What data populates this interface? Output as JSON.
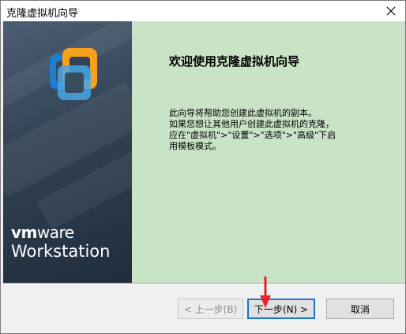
{
  "window": {
    "title": "克隆虚拟机向导"
  },
  "sidebar": {
    "brand_vm": "vm",
    "brand_ware": "ware",
    "brand_product": "Workstation"
  },
  "content": {
    "heading": "欢迎使用克隆虚拟机向导",
    "description_lines": [
      "此向导将帮助您创建此虚拟机的副本。",
      "如果您想让其他用户创建此虚拟机的克隆，",
      "应在\"虚拟机\">\"设置\">\"选项\">\"高级\"下启",
      "用模板模式。"
    ]
  },
  "buttons": {
    "back": "< 上一步(B)",
    "next": "下一步(N) >",
    "cancel": "取消"
  },
  "colors": {
    "content_bg": "#c8e3c6",
    "sidebar_bg": "#314254",
    "next_focus_border": "#1a73d4",
    "annotation_arrow": "#e5232b"
  }
}
